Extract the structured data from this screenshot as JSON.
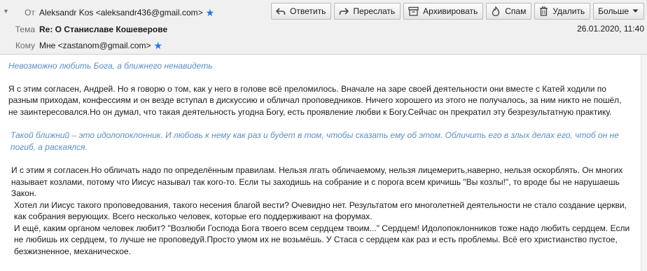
{
  "header": {
    "from_label": "От",
    "from_value": "Aleksandr Kos <aleksandr436@gmail.com>",
    "subject_label": "Тема",
    "subject_value": "Re: О Станиславе Кошеверове",
    "to_label": "Кому",
    "to_value": "Мне <zastanom@gmail.com>",
    "date": "26.01.2020, 11:40"
  },
  "toolbar": {
    "reply": "Ответить",
    "forward": "Переслать",
    "archive": "Архивировать",
    "spam": "Спам",
    "delete": "Удалить",
    "more": "Больше"
  },
  "message": {
    "quote1": "Невозможно любить Бога, а ближнего ненавидеть",
    "para1": "Я с этим согласен, Андрей. Но я говорю о том, как у него в голове всё преломилось. Вначале на заре своей деятельности они вместе с Катей ходили по разным приходам, конфессиям и он везде вступал в дискуссию и обличал проповедников. Ничего хорошего из этого не получалось, за ним никто не пошёл, не заинтересовался.Но он думал, что такая деятельность угодна Богу, есть проявление любви к Богу.Сейчас он прекратил эту безрезультатную практику.",
    "quote2": "Такой ближний – это идолопоклонник. И любовь к нему как раз и будет в том, чтобы сказать ему об этом. Обличить его в злых делах его, чтоб он не погиб, а раскаялся.",
    "para2": "И с этим я согласен.Но обличать надо по определённым правилам. Нельзя лгать обличаемому, нельзя лицемерить,наверно, нельзя оскорблять. Он многих называет козлами, потому что Иисус называл так кого-то. Если ты заходишь на собрание и с порога всем кричишь \"Вы козлы!\", то вроде бы не нарушаешь Закон.",
    "para3": "Хотел ли Иисус такого проповедования, такого несения благой вести? Очевидно нет. Результатом его многолетней деятельности не стало создание церкви, как собрания верующих. Всего несколько человек, которые его поддерживают на форумах.",
    "para4": "И ещё, каким органом человек любит?  \"Возлюби Господа Бога твоего всем сердцем твоим...\" Сердцем! Идолопоклонников тоже надо любить сердцем. Если не любишь их сердцем, то лучше не проповедуй.Просто умом их не возьмёшь. У Стаса с сердцем как раз и есть проблемы. Всё его христианство пустое, безжизненное, механическое."
  },
  "colors": {
    "accent": "#1f78e0",
    "quote": "#5b8fc7",
    "spam_icon": "#d0461f"
  }
}
